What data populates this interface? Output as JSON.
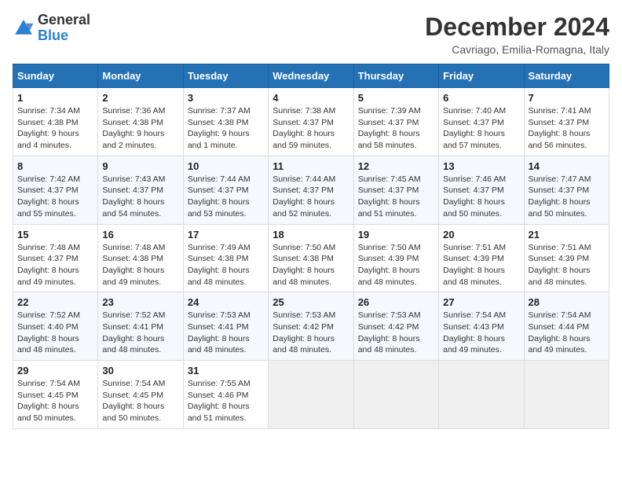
{
  "logo": {
    "general": "General",
    "blue": "Blue"
  },
  "title": "December 2024",
  "location": "Cavriago, Emilia-Romagna, Italy",
  "weekdays": [
    "Sunday",
    "Monday",
    "Tuesday",
    "Wednesday",
    "Thursday",
    "Friday",
    "Saturday"
  ],
  "weeks": [
    [
      {
        "day": "1",
        "sunrise": "Sunrise: 7:34 AM",
        "sunset": "Sunset: 4:38 PM",
        "daylight": "Daylight: 9 hours and 4 minutes."
      },
      {
        "day": "2",
        "sunrise": "Sunrise: 7:36 AM",
        "sunset": "Sunset: 4:38 PM",
        "daylight": "Daylight: 9 hours and 2 minutes."
      },
      {
        "day": "3",
        "sunrise": "Sunrise: 7:37 AM",
        "sunset": "Sunset: 4:38 PM",
        "daylight": "Daylight: 9 hours and 1 minute."
      },
      {
        "day": "4",
        "sunrise": "Sunrise: 7:38 AM",
        "sunset": "Sunset: 4:37 PM",
        "daylight": "Daylight: 8 hours and 59 minutes."
      },
      {
        "day": "5",
        "sunrise": "Sunrise: 7:39 AM",
        "sunset": "Sunset: 4:37 PM",
        "daylight": "Daylight: 8 hours and 58 minutes."
      },
      {
        "day": "6",
        "sunrise": "Sunrise: 7:40 AM",
        "sunset": "Sunset: 4:37 PM",
        "daylight": "Daylight: 8 hours and 57 minutes."
      },
      {
        "day": "7",
        "sunrise": "Sunrise: 7:41 AM",
        "sunset": "Sunset: 4:37 PM",
        "daylight": "Daylight: 8 hours and 56 minutes."
      }
    ],
    [
      {
        "day": "8",
        "sunrise": "Sunrise: 7:42 AM",
        "sunset": "Sunset: 4:37 PM",
        "daylight": "Daylight: 8 hours and 55 minutes."
      },
      {
        "day": "9",
        "sunrise": "Sunrise: 7:43 AM",
        "sunset": "Sunset: 4:37 PM",
        "daylight": "Daylight: 8 hours and 54 minutes."
      },
      {
        "day": "10",
        "sunrise": "Sunrise: 7:44 AM",
        "sunset": "Sunset: 4:37 PM",
        "daylight": "Daylight: 8 hours and 53 minutes."
      },
      {
        "day": "11",
        "sunrise": "Sunrise: 7:44 AM",
        "sunset": "Sunset: 4:37 PM",
        "daylight": "Daylight: 8 hours and 52 minutes."
      },
      {
        "day": "12",
        "sunrise": "Sunrise: 7:45 AM",
        "sunset": "Sunset: 4:37 PM",
        "daylight": "Daylight: 8 hours and 51 minutes."
      },
      {
        "day": "13",
        "sunrise": "Sunrise: 7:46 AM",
        "sunset": "Sunset: 4:37 PM",
        "daylight": "Daylight: 8 hours and 50 minutes."
      },
      {
        "day": "14",
        "sunrise": "Sunrise: 7:47 AM",
        "sunset": "Sunset: 4:37 PM",
        "daylight": "Daylight: 8 hours and 50 minutes."
      }
    ],
    [
      {
        "day": "15",
        "sunrise": "Sunrise: 7:48 AM",
        "sunset": "Sunset: 4:37 PM",
        "daylight": "Daylight: 8 hours and 49 minutes."
      },
      {
        "day": "16",
        "sunrise": "Sunrise: 7:48 AM",
        "sunset": "Sunset: 4:38 PM",
        "daylight": "Daylight: 8 hours and 49 minutes."
      },
      {
        "day": "17",
        "sunrise": "Sunrise: 7:49 AM",
        "sunset": "Sunset: 4:38 PM",
        "daylight": "Daylight: 8 hours and 48 minutes."
      },
      {
        "day": "18",
        "sunrise": "Sunrise: 7:50 AM",
        "sunset": "Sunset: 4:38 PM",
        "daylight": "Daylight: 8 hours and 48 minutes."
      },
      {
        "day": "19",
        "sunrise": "Sunrise: 7:50 AM",
        "sunset": "Sunset: 4:39 PM",
        "daylight": "Daylight: 8 hours and 48 minutes."
      },
      {
        "day": "20",
        "sunrise": "Sunrise: 7:51 AM",
        "sunset": "Sunset: 4:39 PM",
        "daylight": "Daylight: 8 hours and 48 minutes."
      },
      {
        "day": "21",
        "sunrise": "Sunrise: 7:51 AM",
        "sunset": "Sunset: 4:39 PM",
        "daylight": "Daylight: 8 hours and 48 minutes."
      }
    ],
    [
      {
        "day": "22",
        "sunrise": "Sunrise: 7:52 AM",
        "sunset": "Sunset: 4:40 PM",
        "daylight": "Daylight: 8 hours and 48 minutes."
      },
      {
        "day": "23",
        "sunrise": "Sunrise: 7:52 AM",
        "sunset": "Sunset: 4:41 PM",
        "daylight": "Daylight: 8 hours and 48 minutes."
      },
      {
        "day": "24",
        "sunrise": "Sunrise: 7:53 AM",
        "sunset": "Sunset: 4:41 PM",
        "daylight": "Daylight: 8 hours and 48 minutes."
      },
      {
        "day": "25",
        "sunrise": "Sunrise: 7:53 AM",
        "sunset": "Sunset: 4:42 PM",
        "daylight": "Daylight: 8 hours and 48 minutes."
      },
      {
        "day": "26",
        "sunrise": "Sunrise: 7:53 AM",
        "sunset": "Sunset: 4:42 PM",
        "daylight": "Daylight: 8 hours and 48 minutes."
      },
      {
        "day": "27",
        "sunrise": "Sunrise: 7:54 AM",
        "sunset": "Sunset: 4:43 PM",
        "daylight": "Daylight: 8 hours and 49 minutes."
      },
      {
        "day": "28",
        "sunrise": "Sunrise: 7:54 AM",
        "sunset": "Sunset: 4:44 PM",
        "daylight": "Daylight: 8 hours and 49 minutes."
      }
    ],
    [
      {
        "day": "29",
        "sunrise": "Sunrise: 7:54 AM",
        "sunset": "Sunset: 4:45 PM",
        "daylight": "Daylight: 8 hours and 50 minutes."
      },
      {
        "day": "30",
        "sunrise": "Sunrise: 7:54 AM",
        "sunset": "Sunset: 4:45 PM",
        "daylight": "Daylight: 8 hours and 50 minutes."
      },
      {
        "day": "31",
        "sunrise": "Sunrise: 7:55 AM",
        "sunset": "Sunset: 4:46 PM",
        "daylight": "Daylight: 8 hours and 51 minutes."
      },
      null,
      null,
      null,
      null
    ]
  ]
}
